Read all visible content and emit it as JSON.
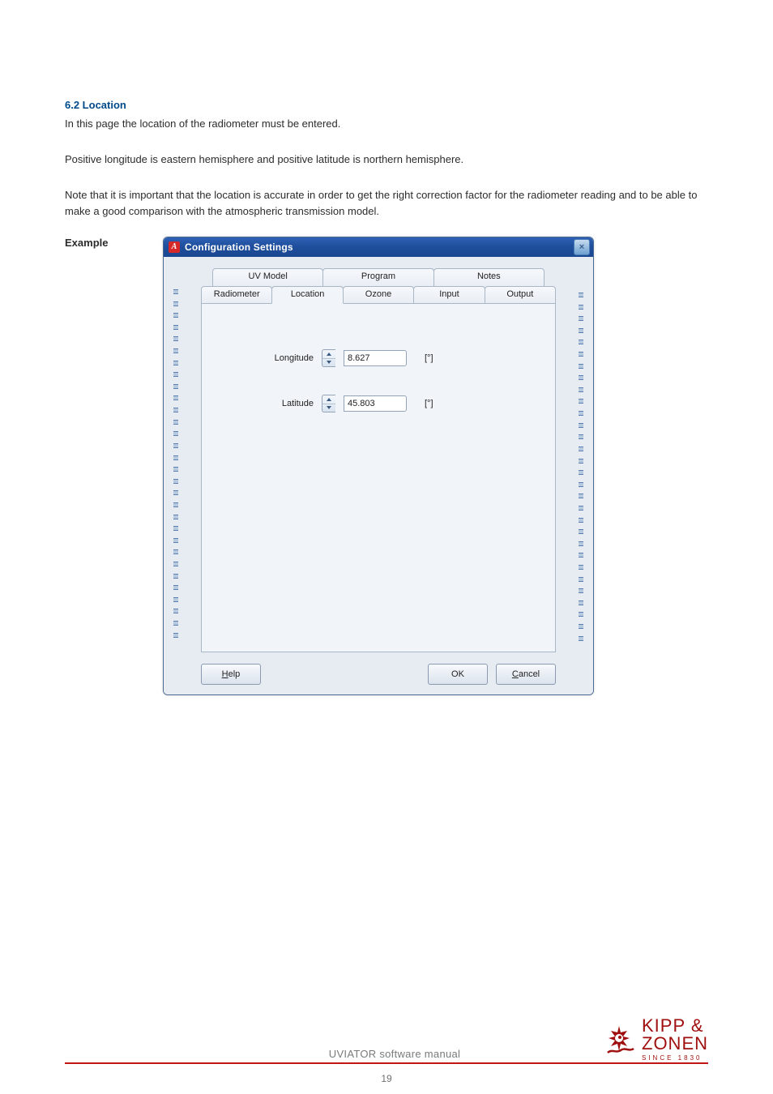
{
  "section": {
    "heading": "6.2 Location",
    "para1": "In this page the location of the radiometer must be entered.",
    "para2": "Positive longitude is eastern hemisphere and positive latitude is northern hemisphere.",
    "para3": "Note that it is important that the location is accurate in order to get the right correction factor for the radiometer reading and to be able to make a good comparison with the atmospheric transmission model.",
    "example_label": "Example"
  },
  "dialog": {
    "title": "Configuration Settings",
    "app_icon_letter": "A",
    "tabs_back": [
      "UV Model",
      "Program",
      "Notes"
    ],
    "tabs_front": [
      "Radiometer",
      "Location",
      "Ozone",
      "Input",
      "Output"
    ],
    "active_front_index": 1,
    "fields": {
      "longitude": {
        "label": "Longitude",
        "value": "8.627",
        "unit": "[°]"
      },
      "latitude": {
        "label": "Latitude",
        "value": "45.803",
        "unit": "[°]"
      }
    },
    "buttons": {
      "help": {
        "text": "Help",
        "underline_first": true
      },
      "ok": {
        "text": "OK",
        "underline_first": false
      },
      "cancel": {
        "text": "Cancel",
        "underline_first": true
      }
    }
  },
  "footer": {
    "manual_title": "UVIATOR software manual",
    "page_number": "19",
    "logo": {
      "line1": "KIPP &",
      "line2": "ZONEN",
      "since": "SINCE 1830"
    }
  }
}
